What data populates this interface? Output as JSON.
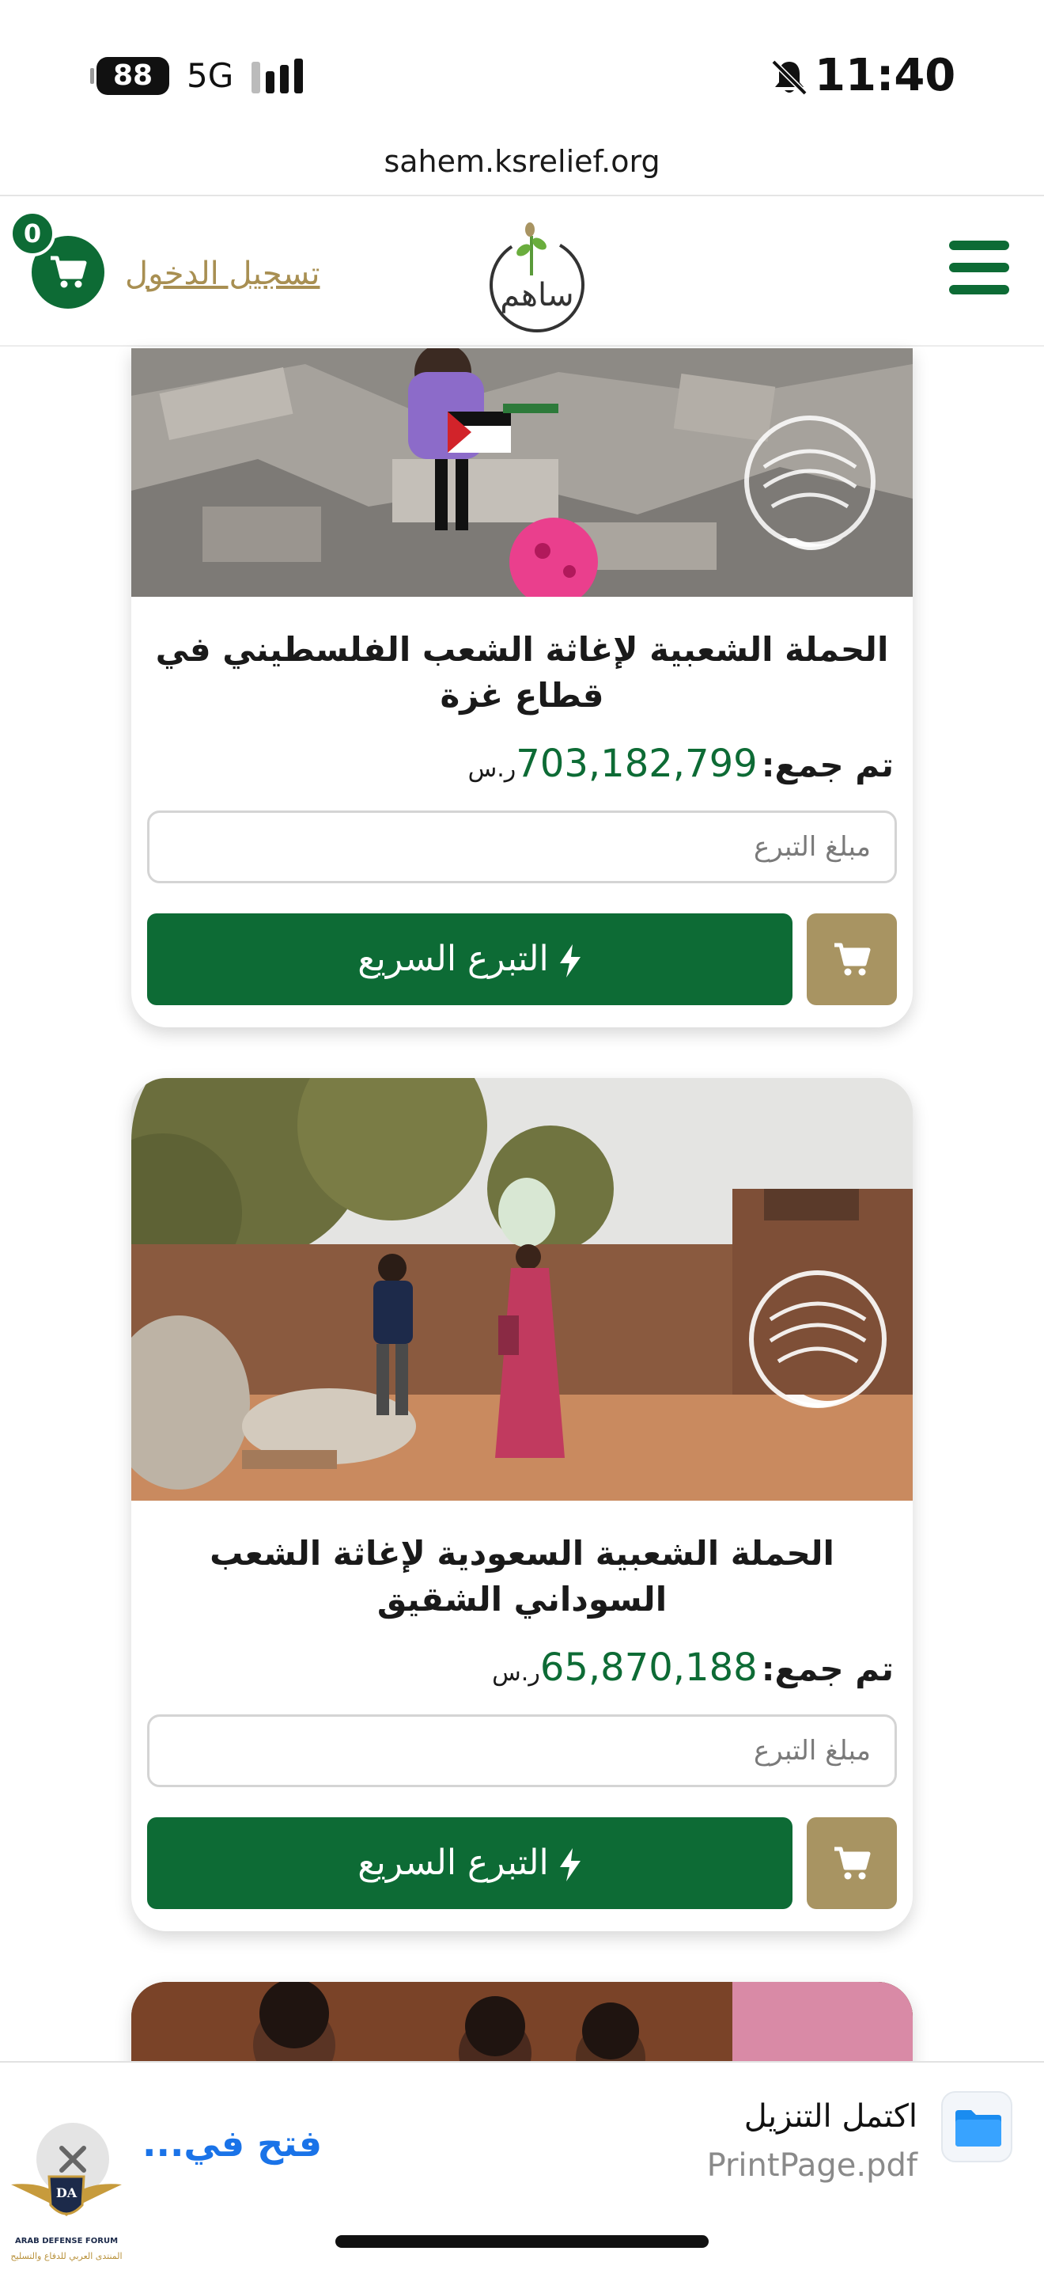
{
  "status_bar": {
    "battery": "88",
    "network": "5G",
    "time": "11:40"
  },
  "browser": {
    "url": "sahem.ksrelief.org"
  },
  "header": {
    "cart_count": "0",
    "login_label": "تسجيل الدخول",
    "logo_text": "ساهم",
    "colors": {
      "brand_green": "#0d6b35",
      "gold": "#a89462"
    }
  },
  "campaigns": [
    {
      "title": "الحملة الشعبية لإغاثة الشعب الفلسطيني في قطاع غزة",
      "raised_label": "تم جمع:",
      "raised_amount": "703,182,799",
      "currency": "ر.س",
      "donation_placeholder": "مبلغ التبرع",
      "quick_donate_label": "التبرع السريع"
    },
    {
      "title": "الحملة الشعبية السعودية لإغاثة الشعب السوداني الشقيق",
      "raised_label": "تم جمع:",
      "raised_amount": "65,870,188",
      "currency": "ر.س",
      "donation_placeholder": "مبلغ التبرع",
      "quick_donate_label": "التبرع السريع"
    }
  ],
  "download_banner": {
    "title": "اكتمل التنزيل",
    "file_name": "PrintPage.pdf",
    "open_in_label": "فتح في..."
  },
  "watermark": {
    "name": "ARAB DEFENSE FORUM",
    "subtitle": "المنتدى العربي للدفاع والتسليح"
  }
}
